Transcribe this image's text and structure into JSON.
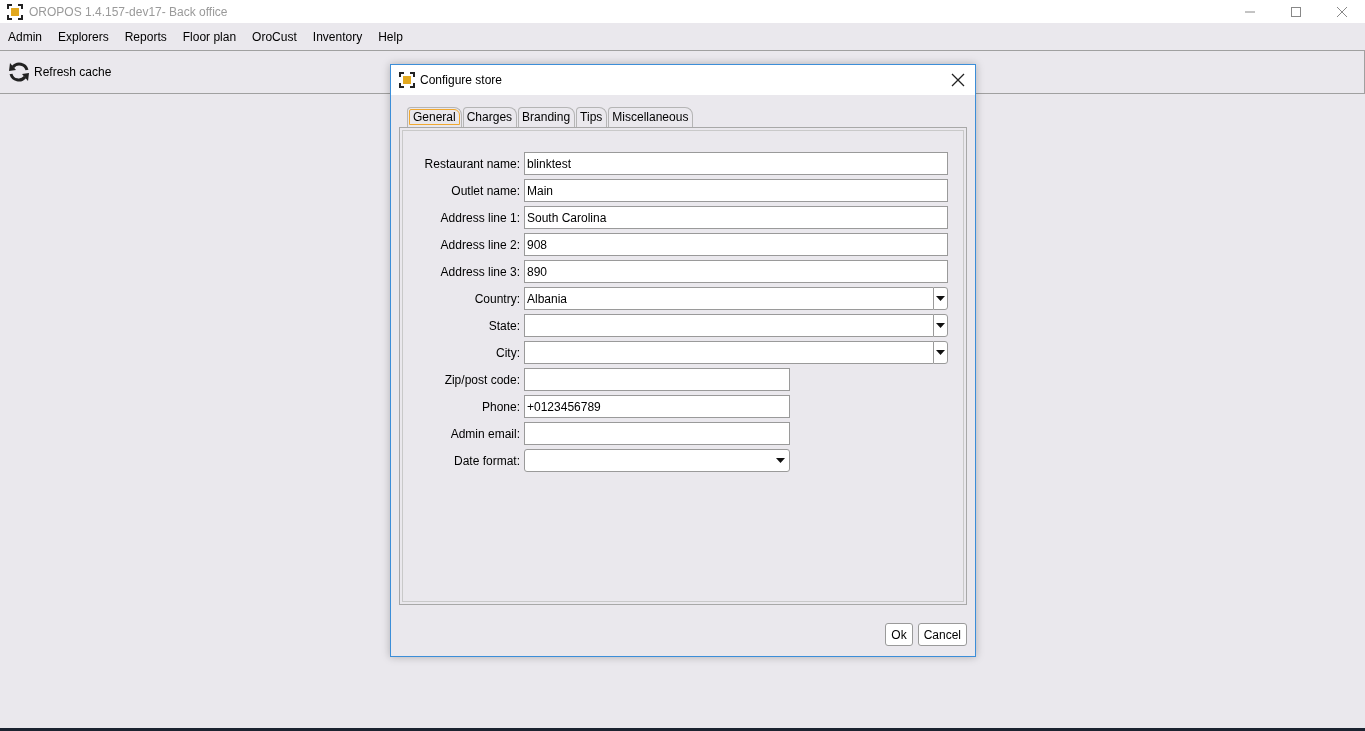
{
  "window": {
    "title": "OROPOS 1.4.157-dev17- Back office"
  },
  "menu": [
    "Admin",
    "Explorers",
    "Reports",
    "Floor plan",
    "OroCust",
    "Inventory",
    "Help"
  ],
  "toolbar": {
    "refresh_label": "Refresh cache"
  },
  "dialog": {
    "title": "Configure store",
    "tabs": [
      {
        "label": "General",
        "selected": true
      },
      {
        "label": "Charges",
        "selected": false
      },
      {
        "label": "Branding",
        "selected": false
      },
      {
        "label": "Tips",
        "selected": false
      },
      {
        "label": "Miscellaneous",
        "selected": false
      }
    ],
    "fields": [
      {
        "label": "Restaurant name:",
        "kind": "text",
        "value": "blinktest"
      },
      {
        "label": "Outlet name:",
        "kind": "text",
        "value": "Main"
      },
      {
        "label": "Address line 1:",
        "kind": "text",
        "value": "South Carolina"
      },
      {
        "label": "Address line 2:",
        "kind": "text",
        "value": "908"
      },
      {
        "label": "Address line 3:",
        "kind": "text",
        "value": "890"
      },
      {
        "label": "Country:",
        "kind": "combo",
        "value": "Albania"
      },
      {
        "label": "State:",
        "kind": "combo"
      },
      {
        "label": "City:",
        "kind": "combo"
      },
      {
        "label": "Zip/post code:",
        "kind": "short-text"
      },
      {
        "label": "Phone:",
        "kind": "short-text",
        "value": "+0123456789"
      },
      {
        "label": "Admin email:",
        "kind": "short-text"
      },
      {
        "label": "Date format:",
        "kind": "select"
      }
    ],
    "buttons": [
      "Ok",
      "Cancel"
    ]
  }
}
